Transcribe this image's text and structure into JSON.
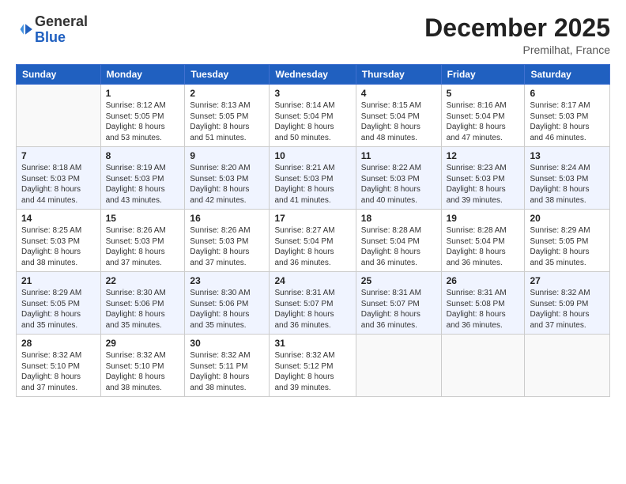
{
  "header": {
    "logo_general": "General",
    "logo_blue": "Blue",
    "month": "December 2025",
    "location": "Premilhat, France"
  },
  "weekdays": [
    "Sunday",
    "Monday",
    "Tuesday",
    "Wednesday",
    "Thursday",
    "Friday",
    "Saturday"
  ],
  "weeks": [
    [
      {
        "day": "",
        "info": ""
      },
      {
        "day": "1",
        "info": "Sunrise: 8:12 AM\nSunset: 5:05 PM\nDaylight: 8 hours\nand 53 minutes."
      },
      {
        "day": "2",
        "info": "Sunrise: 8:13 AM\nSunset: 5:05 PM\nDaylight: 8 hours\nand 51 minutes."
      },
      {
        "day": "3",
        "info": "Sunrise: 8:14 AM\nSunset: 5:04 PM\nDaylight: 8 hours\nand 50 minutes."
      },
      {
        "day": "4",
        "info": "Sunrise: 8:15 AM\nSunset: 5:04 PM\nDaylight: 8 hours\nand 48 minutes."
      },
      {
        "day": "5",
        "info": "Sunrise: 8:16 AM\nSunset: 5:04 PM\nDaylight: 8 hours\nand 47 minutes."
      },
      {
        "day": "6",
        "info": "Sunrise: 8:17 AM\nSunset: 5:03 PM\nDaylight: 8 hours\nand 46 minutes."
      }
    ],
    [
      {
        "day": "7",
        "info": "Sunrise: 8:18 AM\nSunset: 5:03 PM\nDaylight: 8 hours\nand 44 minutes."
      },
      {
        "day": "8",
        "info": "Sunrise: 8:19 AM\nSunset: 5:03 PM\nDaylight: 8 hours\nand 43 minutes."
      },
      {
        "day": "9",
        "info": "Sunrise: 8:20 AM\nSunset: 5:03 PM\nDaylight: 8 hours\nand 42 minutes."
      },
      {
        "day": "10",
        "info": "Sunrise: 8:21 AM\nSunset: 5:03 PM\nDaylight: 8 hours\nand 41 minutes."
      },
      {
        "day": "11",
        "info": "Sunrise: 8:22 AM\nSunset: 5:03 PM\nDaylight: 8 hours\nand 40 minutes."
      },
      {
        "day": "12",
        "info": "Sunrise: 8:23 AM\nSunset: 5:03 PM\nDaylight: 8 hours\nand 39 minutes."
      },
      {
        "day": "13",
        "info": "Sunrise: 8:24 AM\nSunset: 5:03 PM\nDaylight: 8 hours\nand 38 minutes."
      }
    ],
    [
      {
        "day": "14",
        "info": "Sunrise: 8:25 AM\nSunset: 5:03 PM\nDaylight: 8 hours\nand 38 minutes."
      },
      {
        "day": "15",
        "info": "Sunrise: 8:26 AM\nSunset: 5:03 PM\nDaylight: 8 hours\nand 37 minutes."
      },
      {
        "day": "16",
        "info": "Sunrise: 8:26 AM\nSunset: 5:03 PM\nDaylight: 8 hours\nand 37 minutes."
      },
      {
        "day": "17",
        "info": "Sunrise: 8:27 AM\nSunset: 5:04 PM\nDaylight: 8 hours\nand 36 minutes."
      },
      {
        "day": "18",
        "info": "Sunrise: 8:28 AM\nSunset: 5:04 PM\nDaylight: 8 hours\nand 36 minutes."
      },
      {
        "day": "19",
        "info": "Sunrise: 8:28 AM\nSunset: 5:04 PM\nDaylight: 8 hours\nand 36 minutes."
      },
      {
        "day": "20",
        "info": "Sunrise: 8:29 AM\nSunset: 5:05 PM\nDaylight: 8 hours\nand 35 minutes."
      }
    ],
    [
      {
        "day": "21",
        "info": "Sunrise: 8:29 AM\nSunset: 5:05 PM\nDaylight: 8 hours\nand 35 minutes."
      },
      {
        "day": "22",
        "info": "Sunrise: 8:30 AM\nSunset: 5:06 PM\nDaylight: 8 hours\nand 35 minutes."
      },
      {
        "day": "23",
        "info": "Sunrise: 8:30 AM\nSunset: 5:06 PM\nDaylight: 8 hours\nand 35 minutes."
      },
      {
        "day": "24",
        "info": "Sunrise: 8:31 AM\nSunset: 5:07 PM\nDaylight: 8 hours\nand 36 minutes."
      },
      {
        "day": "25",
        "info": "Sunrise: 8:31 AM\nSunset: 5:07 PM\nDaylight: 8 hours\nand 36 minutes."
      },
      {
        "day": "26",
        "info": "Sunrise: 8:31 AM\nSunset: 5:08 PM\nDaylight: 8 hours\nand 36 minutes."
      },
      {
        "day": "27",
        "info": "Sunrise: 8:32 AM\nSunset: 5:09 PM\nDaylight: 8 hours\nand 37 minutes."
      }
    ],
    [
      {
        "day": "28",
        "info": "Sunrise: 8:32 AM\nSunset: 5:10 PM\nDaylight: 8 hours\nand 37 minutes."
      },
      {
        "day": "29",
        "info": "Sunrise: 8:32 AM\nSunset: 5:10 PM\nDaylight: 8 hours\nand 38 minutes."
      },
      {
        "day": "30",
        "info": "Sunrise: 8:32 AM\nSunset: 5:11 PM\nDaylight: 8 hours\nand 38 minutes."
      },
      {
        "day": "31",
        "info": "Sunrise: 8:32 AM\nSunset: 5:12 PM\nDaylight: 8 hours\nand 39 minutes."
      },
      {
        "day": "",
        "info": ""
      },
      {
        "day": "",
        "info": ""
      },
      {
        "day": "",
        "info": ""
      }
    ]
  ]
}
